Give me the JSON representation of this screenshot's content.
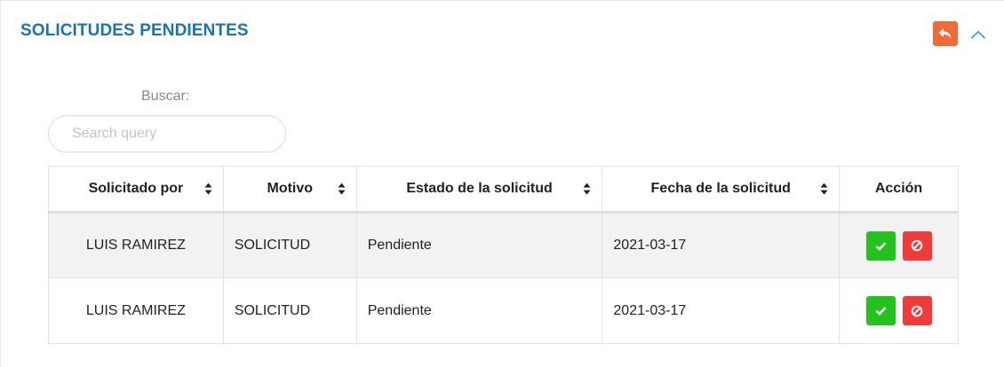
{
  "panel": {
    "title": "SOLICITUDES PENDIENTES",
    "back_icon": "reply-icon",
    "collapse_icon": "chevron-up-icon"
  },
  "search": {
    "label": "Buscar:",
    "placeholder": "Search query",
    "value": ""
  },
  "table": {
    "columns": [
      {
        "label": "Solicitado por",
        "sortable": true
      },
      {
        "label": "Motivo",
        "sortable": true
      },
      {
        "label": "Estado de la solicitud",
        "sortable": true
      },
      {
        "label": "Fecha de la solicitud",
        "sortable": true
      },
      {
        "label": "Acción",
        "sortable": false
      }
    ],
    "rows": [
      {
        "solicitado_por": "LUIS RAMIREZ",
        "motivo": "SOLICITUD",
        "estado": "Pendiente",
        "fecha": "2021-03-17"
      },
      {
        "solicitado_por": "LUIS RAMIREZ",
        "motivo": "SOLICITUD",
        "estado": "Pendiente",
        "fecha": "2021-03-17"
      }
    ],
    "actions": {
      "approve_icon": "check-icon",
      "reject_icon": "ban-icon"
    }
  },
  "colors": {
    "title": "#1a73b0",
    "back_button": "#f26a35",
    "approve": "#22c31a",
    "reject": "#f23a3a",
    "striped_row": "#f2f2f2"
  }
}
